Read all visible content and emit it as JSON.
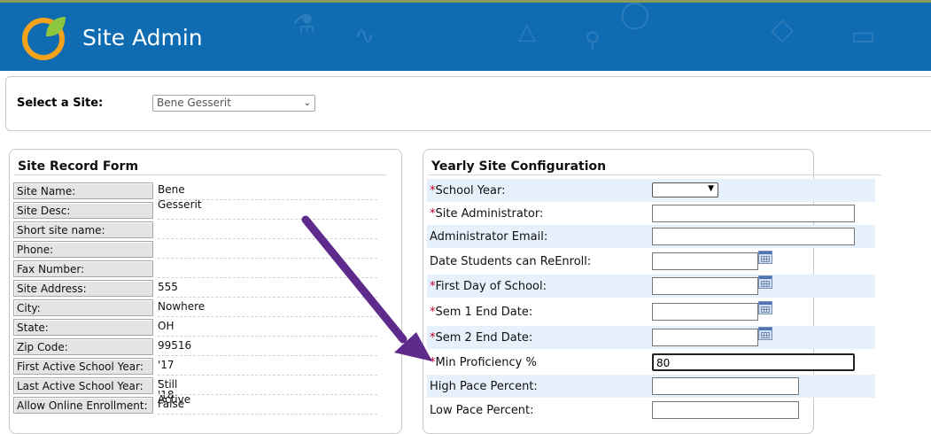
{
  "header": {
    "title": "Site Admin"
  },
  "site_selector": {
    "label": "Select a Site:",
    "selected": "Bene Gesserit"
  },
  "record_form": {
    "title": "Site Record Form",
    "fields": [
      {
        "label": "Site Name:",
        "value": "Bene Gesserit"
      },
      {
        "label": "Site Desc:",
        "value": ""
      },
      {
        "label": "Short site name:",
        "value": ""
      },
      {
        "label": "Phone:",
        "value": ""
      },
      {
        "label": "Fax Number:",
        "value": ""
      },
      {
        "label": "Site Address:",
        "value": "555"
      },
      {
        "label": "City:",
        "value": "Nowhere"
      },
      {
        "label": "State:",
        "value": "OH"
      },
      {
        "label": "Zip Code:",
        "value": "99516"
      },
      {
        "label": "First Active School Year:",
        "value": "'17 - '18"
      },
      {
        "label": "Last Active School Year:",
        "value": "Still Active"
      },
      {
        "label": "Allow Online Enrollment:",
        "value": "False"
      }
    ]
  },
  "yearly_config": {
    "title": "Yearly Site Configuration",
    "required_mark": "*",
    "fields": [
      {
        "label": "School Year:",
        "required": true,
        "value": ""
      },
      {
        "label": "Site Administrator:",
        "required": true,
        "value": ""
      },
      {
        "label": "Administrator Email:",
        "required": false,
        "value": ""
      },
      {
        "label": "Date Students can ReEnroll:",
        "required": false,
        "value": ""
      },
      {
        "label": "First Day of School:",
        "required": true,
        "value": ""
      },
      {
        "label": "Sem 1 End Date:",
        "required": true,
        "value": ""
      },
      {
        "label": "Sem 2 End Date:",
        "required": true,
        "value": ""
      },
      {
        "label": "Min Proficiency %",
        "required": true,
        "value": "80"
      },
      {
        "label": "High Pace Percent:",
        "required": false,
        "value": ""
      },
      {
        "label": "Low Pace Percent:",
        "required": false,
        "value": ""
      }
    ]
  },
  "colors": {
    "header_bg": "#0f6bb2",
    "arrow": "#5e2a8c",
    "required": "#c0002a",
    "row_highlight": "#e7f1fb"
  },
  "icons": {
    "logo": "site-logo",
    "calendar": "calendar-icon",
    "annotation": "arrow-annotation"
  }
}
